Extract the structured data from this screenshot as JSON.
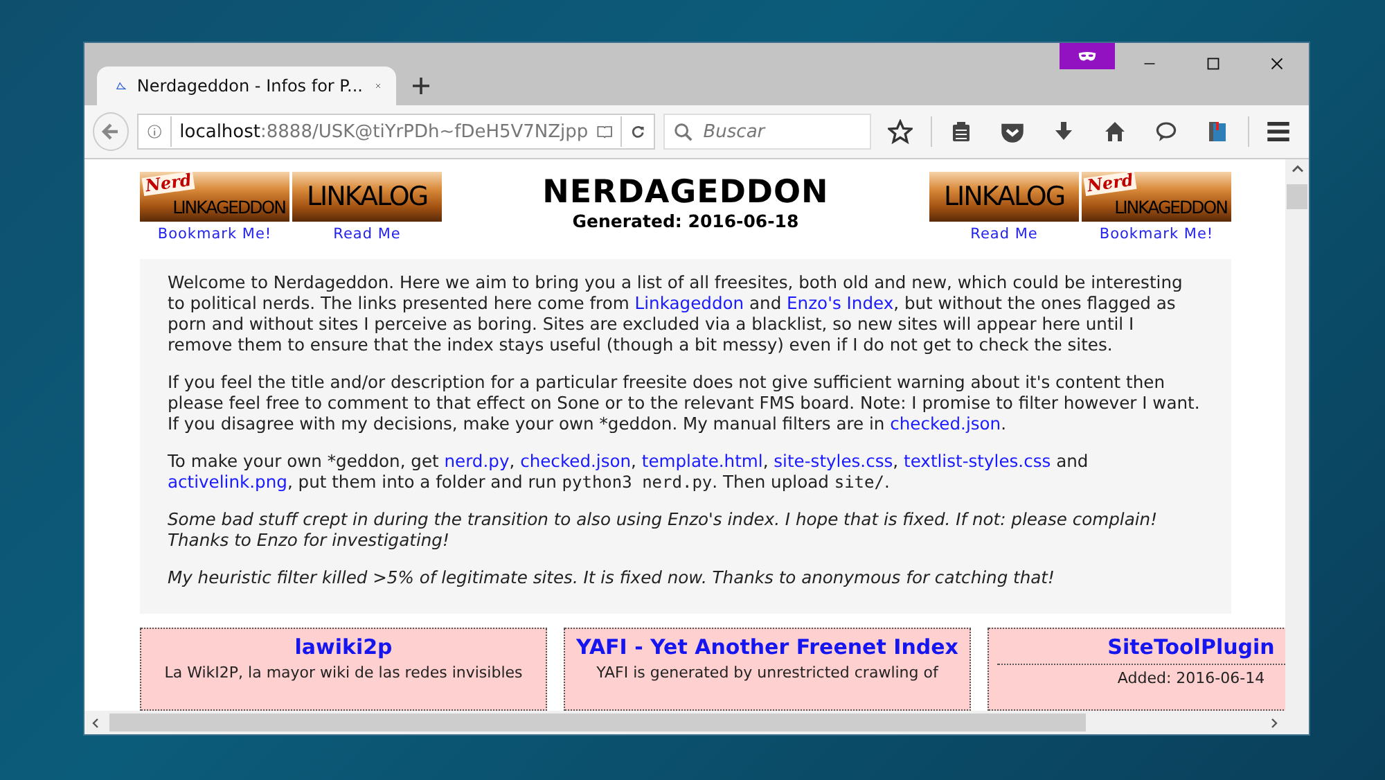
{
  "tab": {
    "title": "Nerdageddon - Infos for P...",
    "selected": true
  },
  "address": {
    "host": "localhost",
    "path": ":8888/USK@tiYrPDh~fDeH5V7NZjpp"
  },
  "search": {
    "placeholder": "Buscar"
  },
  "header": {
    "left_banners": [
      {
        "banner": "LINKAGEDDON",
        "overlay": "Nerd",
        "caption": "Bookmark Me!"
      },
      {
        "banner": "LINKALOG",
        "caption": "Read Me"
      }
    ],
    "title": "NERDAGEDDON",
    "generated": "Generated: 2016-06-18",
    "right_banners": [
      {
        "banner": "LINKALOG",
        "caption": "Read Me"
      },
      {
        "banner": "LINKAGEDDON",
        "overlay": "Nerd",
        "caption": "Bookmark Me!"
      }
    ]
  },
  "intro": [
    {
      "italic": false,
      "parts": [
        {
          "kind": "text",
          "text": "Welcome to Nerdageddon. Here we aim to bring you a list of all freesites, both old and new, which could be interesting to political nerds. The links presented here come from "
        },
        {
          "kind": "link",
          "text": "Linkageddon"
        },
        {
          "kind": "text",
          "text": " and "
        },
        {
          "kind": "link",
          "text": "Enzo's Index"
        },
        {
          "kind": "text",
          "text": ", but without the ones flagged as porn and without sites I perceive as boring. Sites are excluded via a blacklist, so new sites will appear here until I remove them to ensure that the index stays useful (though a bit messy) even if I do not get to check the sites."
        }
      ]
    },
    {
      "italic": false,
      "parts": [
        {
          "kind": "text",
          "text": "If you feel the title and/or description for a particular freesite does not give sufficient warning about it's content then please feel free to comment to that effect on Sone or to the relevant FMS board. Note: I promise to filter however I want. If you disagree with my decisions, make your own *geddon. My manual filters are in "
        },
        {
          "kind": "link",
          "text": "checked.json"
        },
        {
          "kind": "text",
          "text": "."
        }
      ]
    },
    {
      "italic": false,
      "parts": [
        {
          "kind": "text",
          "text": "To make your own *geddon, get "
        },
        {
          "kind": "link",
          "text": "nerd.py"
        },
        {
          "kind": "text",
          "text": ", "
        },
        {
          "kind": "link",
          "text": "checked.json"
        },
        {
          "kind": "text",
          "text": ", "
        },
        {
          "kind": "link",
          "text": "template.html"
        },
        {
          "kind": "text",
          "text": ", "
        },
        {
          "kind": "link",
          "text": "site-styles.css"
        },
        {
          "kind": "text",
          "text": ", "
        },
        {
          "kind": "link",
          "text": "textlist-styles.css"
        },
        {
          "kind": "text",
          "text": " and "
        },
        {
          "kind": "link",
          "text": "activelink.png"
        },
        {
          "kind": "text",
          "text": ", put them into a folder and run "
        },
        {
          "kind": "code",
          "text": "python3 nerd.py"
        },
        {
          "kind": "text",
          "text": ". Then upload "
        },
        {
          "kind": "code",
          "text": "site/"
        },
        {
          "kind": "text",
          "text": "."
        }
      ]
    },
    {
      "italic": true,
      "parts": [
        {
          "kind": "text",
          "text": "Some bad stuff crept in during the transition to also using Enzo's index. I hope that is fixed. If not: please complain! Thanks to Enzo for investigating!"
        }
      ]
    },
    {
      "italic": true,
      "parts": [
        {
          "kind": "text",
          "text": "My heuristic filter killed >5% of legitimate sites. It is fixed now. Thanks to anonymous for catching that!"
        }
      ]
    }
  ],
  "sites": [
    {
      "title": "lawiki2p",
      "kind": "description",
      "text": "La WikI2P, la mayor wiki de las redes invisibles"
    },
    {
      "title": "YAFI - Yet Another Freenet Index",
      "kind": "description",
      "text": "YAFI is generated by unrestricted crawling of"
    },
    {
      "title": "SiteToolPlugin",
      "kind": "added",
      "text": "Added: 2016-06-14"
    }
  ]
}
